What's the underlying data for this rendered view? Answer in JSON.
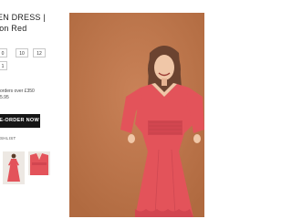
{
  "product": {
    "title_line1": "EN DRESS |",
    "title_line2": "ion Red"
  },
  "sizes": [
    "0",
    "10",
    "12",
    "1"
  ],
  "shipping": {
    "line1": "orders over £350",
    "line2": "5.95"
  },
  "cta_label": "RE-ORDER NOW",
  "wishlist_label": "SHLIST",
  "colors": {
    "background": "#ffffff",
    "photo_backdrop": "#c0794a",
    "dress": "#e3535a",
    "button": "#161616"
  },
  "icons": [
    "dress-photo"
  ]
}
